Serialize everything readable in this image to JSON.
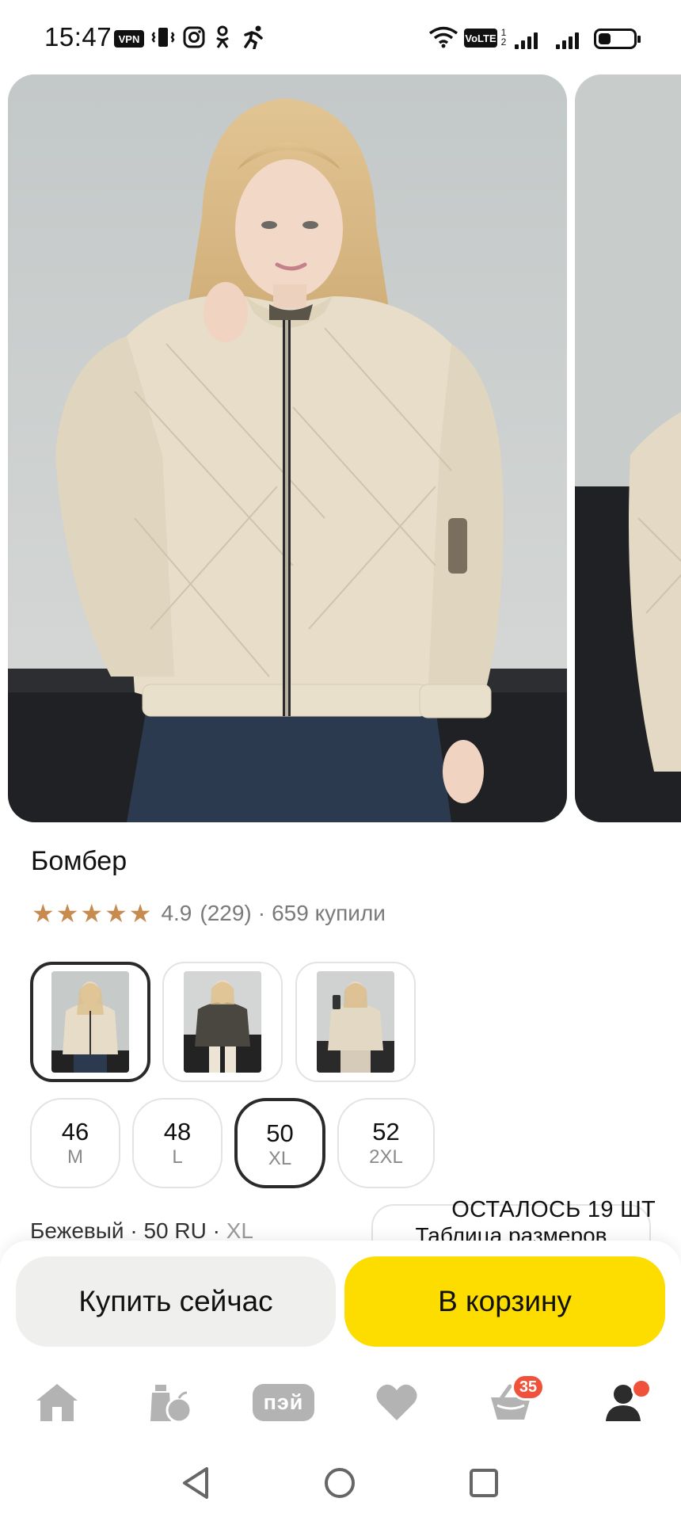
{
  "status_bar": {
    "time": "15:47",
    "vpn_label": "VPN",
    "volte_label": "VoLTE",
    "sim_numbers": [
      "1",
      "2"
    ],
    "icons": [
      "vibrate-icon",
      "instagram-icon",
      "ok-icon",
      "activity-icon",
      "wifi-icon",
      "signal-icon",
      "battery-icon"
    ],
    "battery_level": 0.35
  },
  "gallery": {
    "images": [
      "jacket-beige-front",
      "jacket-beige-side"
    ]
  },
  "product": {
    "title": "Бомбер",
    "rating": "4.9",
    "reviews": "(229)",
    "separator": "·",
    "bought": "659 купили",
    "stars_count": 5,
    "star_color": "#c78a4f"
  },
  "colors": [
    {
      "name": "beige",
      "selected": true
    },
    {
      "name": "graphite",
      "selected": false
    },
    {
      "name": "light-beige",
      "selected": false
    }
  ],
  "sizes": [
    {
      "ru": "46",
      "intl": "M",
      "selected": false
    },
    {
      "ru": "48",
      "intl": "L",
      "selected": false
    },
    {
      "ru": "50",
      "intl": "XL",
      "selected": true
    },
    {
      "ru": "52",
      "intl": "2XL",
      "selected": false
    }
  ],
  "selection": {
    "color": "Бежевый",
    "dot1": " · ",
    "size_ru": "50 RU",
    "dot2": " · ",
    "size_intl": "XL",
    "size_table": "Таблица размеров",
    "stock": "ОСТАЛОСЬ 19 ШТ"
  },
  "actions": {
    "buy_now": "Купить сейчас",
    "to_cart": "В корзину",
    "buy_now_bg": "#efefed",
    "to_cart_bg": "#fddc00"
  },
  "tab_bar": {
    "items": [
      "home-icon",
      "catalog-icon",
      "pay-icon",
      "favorites-icon",
      "cart-icon",
      "profile-icon"
    ],
    "pay_label": "пэй",
    "cart_count": "35",
    "badge_color": "#f0513a"
  },
  "system_nav": {
    "items": [
      "back-icon",
      "home-circle-icon",
      "recent-apps-icon"
    ]
  }
}
